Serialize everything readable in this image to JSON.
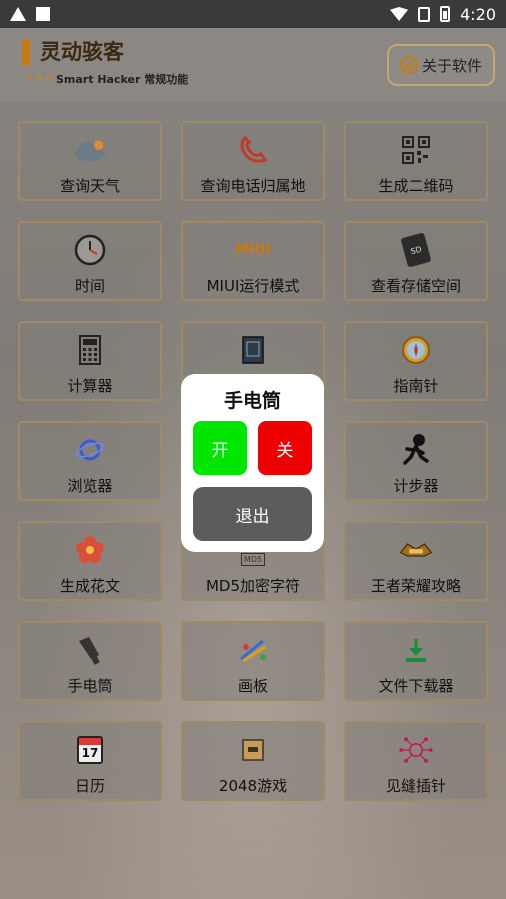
{
  "status_bar": {
    "time": "4:20"
  },
  "header": {
    "title": "灵动骇客",
    "subtitle": "Smart Hacker 常规功能",
    "about_label": "关于软件",
    "about_icon_glyph": "@"
  },
  "tiles": [
    {
      "label": "查询天气",
      "icon": "cloud-icon"
    },
    {
      "label": "查询电话归属地",
      "icon": "phone-icon"
    },
    {
      "label": "生成二维码",
      "icon": "qrcode-icon"
    },
    {
      "label": "时间",
      "icon": "clock-icon"
    },
    {
      "label": "MIUI运行模式",
      "icon": "miui-icon",
      "icon_text": "MIUI"
    },
    {
      "label": "查看存储空间",
      "icon": "sd-card-icon",
      "icon_text": "SD"
    },
    {
      "label": "计算器",
      "icon": "calculator-icon"
    },
    {
      "label": "",
      "icon": "notebook-icon"
    },
    {
      "label": "指南针",
      "icon": "compass-icon"
    },
    {
      "label": "浏览器",
      "icon": "browser-icon"
    },
    {
      "label": "",
      "icon": ""
    },
    {
      "label": "计步器",
      "icon": "runner-icon"
    },
    {
      "label": "生成花文",
      "icon": "flower-icon"
    },
    {
      "label": "MD5加密字符",
      "icon": "md5-icon",
      "icon_text": "MD5"
    },
    {
      "label": "王者荣耀攻略",
      "icon": "game-logo-icon"
    },
    {
      "label": "手电筒",
      "icon": "flashlight-icon"
    },
    {
      "label": "画板",
      "icon": "paint-icon"
    },
    {
      "label": "文件下载器",
      "icon": "download-icon"
    },
    {
      "label": "日历",
      "icon": "calendar-icon",
      "icon_text": "17"
    },
    {
      "label": "2048游戏",
      "icon": "game2048-icon"
    },
    {
      "label": "见缝插针",
      "icon": "pin-icon"
    }
  ],
  "dialog": {
    "title": "手电筒",
    "on_label": "开",
    "off_label": "关",
    "exit_label": "退出"
  },
  "colors": {
    "accent": "#c77a0f",
    "on": "#00e600",
    "off": "#ee0000",
    "exit": "#5c5c5c"
  }
}
